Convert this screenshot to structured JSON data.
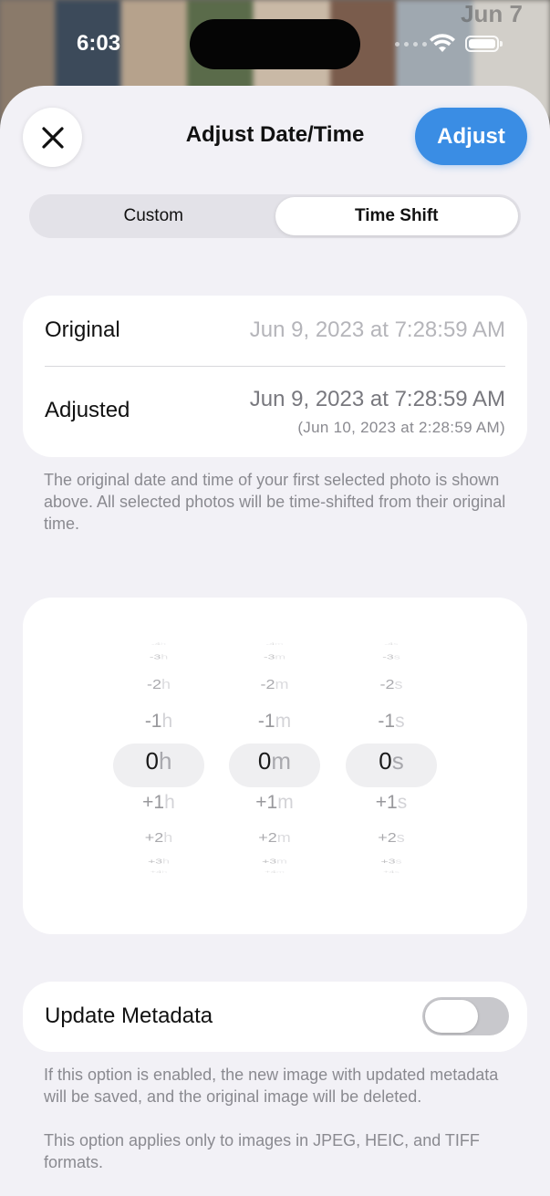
{
  "status_bar": {
    "time": "6:03"
  },
  "backdrop": {
    "date_label": "Jun 7"
  },
  "sheet": {
    "title": "Adjust Date/Time",
    "adjust_label": "Adjust"
  },
  "segmented": {
    "options": [
      "Custom",
      "Time Shift"
    ],
    "selected": "Time Shift"
  },
  "datetime": {
    "original_label": "Original",
    "original_value": "Jun 9, 2023 at 7:28:59 AM",
    "adjusted_label": "Adjusted",
    "adjusted_value": "Jun 9, 2023 at 7:28:59 AM",
    "adjusted_sub": "(Jun 10, 2023 at 2:28:59 AM)"
  },
  "footnote_shift": "The original date and time of your first selected photo is shown above. All selected photos will be time-shifted from their original time.",
  "picker": {
    "columns": [
      {
        "unit": "h",
        "values": [
          "-4",
          "-3",
          "-2",
          "-1",
          "0",
          "+1",
          "+2",
          "+3",
          "+4"
        ]
      },
      {
        "unit": "m",
        "values": [
          "-4",
          "-3",
          "-2",
          "-1",
          "0",
          "+1",
          "+2",
          "+3",
          "+4"
        ]
      },
      {
        "unit": "s",
        "values": [
          "-4",
          "-3",
          "-2",
          "-1",
          "0",
          "+1",
          "+2",
          "+3",
          "+4"
        ]
      }
    ],
    "selected": {
      "h": "0",
      "m": "0",
      "s": "0"
    }
  },
  "metadata": {
    "label": "Update Metadata",
    "enabled": false
  },
  "footnote_metadata": [
    "If this option is enabled, the new image with updated metadata will be saved, and the original image will be deleted.",
    "This option applies only to images in JPEG, HEIC, and TIFF formats."
  ],
  "colors": {
    "accent": "#3a8de4",
    "sheet_background": "#f2f1f6",
    "card_background": "#ffffff",
    "secondary_text": "#8a8a90"
  },
  "icons": {
    "close": "close-icon",
    "wifi": "wifi-icon",
    "battery": "battery-icon"
  }
}
